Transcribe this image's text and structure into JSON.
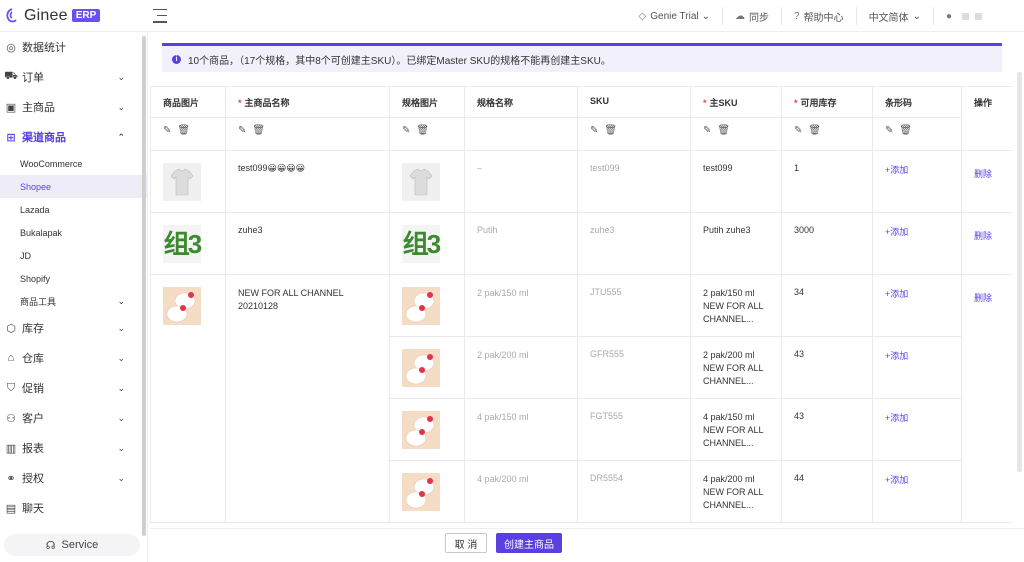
{
  "header": {
    "logo_text": "Ginee",
    "logo_badge": "ERP",
    "items": [
      {
        "icon": "diamond-icon",
        "label": "Genie Trial"
      },
      {
        "icon": "cloud-sync-icon",
        "label": "同步"
      },
      {
        "icon": "help-icon",
        "label": "帮助中心"
      },
      {
        "icon": "none",
        "label": "中文简体"
      }
    ]
  },
  "sidebar": {
    "items": [
      {
        "label": "数据统计"
      },
      {
        "label": "订单"
      },
      {
        "label": "主商品"
      },
      {
        "label": "渠道商品"
      },
      {
        "label": "库存"
      },
      {
        "label": "仓库"
      },
      {
        "label": "促销"
      },
      {
        "label": "客户"
      },
      {
        "label": "报表"
      },
      {
        "label": "授权"
      },
      {
        "label": "聊天"
      }
    ],
    "sub_items": [
      {
        "label": "WooCommerce"
      },
      {
        "label": "Shopee"
      },
      {
        "label": "Lazada"
      },
      {
        "label": "Bukalapak"
      },
      {
        "label": "JD"
      },
      {
        "label": "Shopify"
      },
      {
        "label": "商品工具"
      }
    ],
    "service_label": "Service"
  },
  "banner": {
    "text": "10个商品，（17个规格，其中8个可创建主SKU）。已绑定Master SKU的规格不能再创建主SKU。"
  },
  "table": {
    "headers": {
      "product_image": "商品图片",
      "master_name": "主商品名称",
      "variant_image": "规格图片",
      "variant_name": "规格名称",
      "sku": "SKU",
      "master_sku": "主SKU",
      "stock": "可用库存",
      "barcode": "条形码",
      "action": "操作"
    },
    "products": [
      {
        "name": "test099😀😀😀😀",
        "action": "删除",
        "image_text": "",
        "variants": [
          {
            "variant_name": "–",
            "sku": "test099",
            "master_sku": "test099",
            "stock": "1",
            "barcode": "+添加"
          }
        ]
      },
      {
        "name": "zuhe3",
        "action": "删除",
        "image_text": "组3",
        "variants": [
          {
            "variant_name": "Putih",
            "sku": "zuhe3",
            "master_sku": "Putih zuhe3",
            "stock": "3000",
            "barcode": "+添加"
          }
        ]
      },
      {
        "name": "NEW FOR ALL CHANNEL 20210128",
        "action": "删除",
        "image_text": "",
        "variants": [
          {
            "variant_name": "2 pak/150 ml",
            "sku": "JTU555",
            "master_sku": "2 pak/150 ml NEW FOR ALL CHANNEL...",
            "stock": "34",
            "barcode": "+添加"
          },
          {
            "variant_name": "2 pak/200 ml",
            "sku": "GFR555",
            "master_sku": "2 pak/200 ml NEW FOR ALL CHANNEL...",
            "stock": "43",
            "barcode": "+添加"
          },
          {
            "variant_name": "4 pak/150 ml",
            "sku": "FGT555",
            "master_sku": "4 pak/150 ml NEW FOR ALL CHANNEL...",
            "stock": "43",
            "barcode": "+添加"
          },
          {
            "variant_name": "4 pak/200 ml",
            "sku": "DR5554",
            "master_sku": "4 pak/200 ml NEW FOR ALL CHANNEL...",
            "stock": "44",
            "barcode": "+添加"
          }
        ]
      }
    ]
  },
  "footer": {
    "cancel_label": "取 消",
    "create_label": "创建主商品"
  },
  "colors": {
    "accent": "#5b3fe0",
    "required": "#e0494a",
    "banner_bg": "#f1f0fb"
  }
}
